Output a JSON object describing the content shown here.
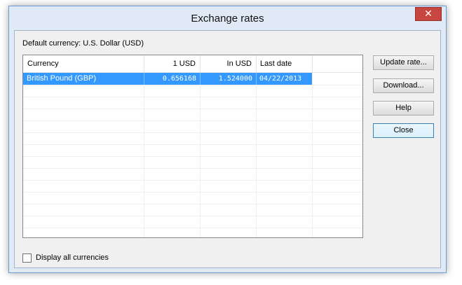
{
  "window": {
    "title": "Exchange rates",
    "close_glyph": "✕"
  },
  "default_currency_label": "Default currency: U.S. Dollar (USD)",
  "table": {
    "columns": [
      "Currency",
      "1 USD",
      "In USD",
      "Last date"
    ],
    "rows": [
      {
        "currency": "British Pound (GBP)",
        "one_usd": "0.656168",
        "in_usd": "1.524000",
        "last_date": "04/22/2013",
        "selected": true
      }
    ]
  },
  "buttons": {
    "update_rate": "Update rate...",
    "download": "Download...",
    "help": "Help",
    "close": "Close"
  },
  "display_all_currencies": {
    "label": "Display all currencies",
    "checked": false
  },
  "colors": {
    "selection": "#3399ff",
    "close_button": "#c7463f",
    "window_frame": "#dfeaf6"
  }
}
